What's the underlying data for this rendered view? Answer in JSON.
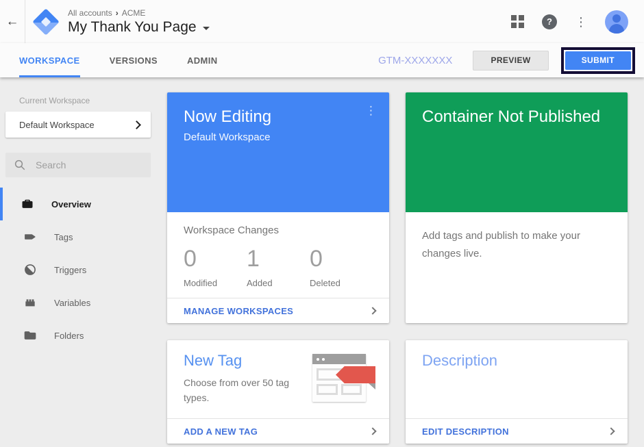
{
  "topbar": {
    "back_glyph": "←",
    "breadcrumb": {
      "account_level": "All accounts",
      "separator": "›",
      "account": "ACME"
    },
    "title": "My Thank You Page",
    "help_glyph": "?",
    "more_glyph": "⋮",
    "now_editing_dots": "⋮"
  },
  "tabbar": {
    "tabs": [
      {
        "label": "WORKSPACE",
        "active": true
      },
      {
        "label": "VERSIONS",
        "active": false
      },
      {
        "label": "ADMIN",
        "active": false
      }
    ],
    "container_id": "GTM-XXXXXXX",
    "preview_label": "PREVIEW",
    "submit_label": "SUBMIT"
  },
  "sidebar": {
    "current_workspace_label": "Current Workspace",
    "workspace_name": "Default Workspace",
    "search_placeholder": "Search",
    "nav": [
      {
        "label": "Overview",
        "icon": "overview-icon",
        "selected": true
      },
      {
        "label": "Tags",
        "icon": "tag-icon",
        "selected": false
      },
      {
        "label": "Triggers",
        "icon": "trigger-icon",
        "selected": false
      },
      {
        "label": "Variables",
        "icon": "variable-icon",
        "selected": false
      },
      {
        "label": "Folders",
        "icon": "folder-icon",
        "selected": false
      }
    ]
  },
  "cards": {
    "now_editing": {
      "title": "Now Editing",
      "subtitle": "Default Workspace",
      "section_title": "Workspace Changes",
      "stats": [
        {
          "value": "0",
          "label": "Modified"
        },
        {
          "value": "1",
          "label": "Added"
        },
        {
          "value": "0",
          "label": "Deleted"
        }
      ],
      "footer_label": "MANAGE WORKSPACES"
    },
    "container_status": {
      "title": "Container Not Published",
      "body": "Add tags and publish to make your changes live."
    },
    "new_tag": {
      "title": "New Tag",
      "body": "Choose from over 50 tag types.",
      "footer_label": "ADD A NEW TAG"
    },
    "description": {
      "title": "Description",
      "footer_label": "EDIT DESCRIPTION"
    }
  },
  "colors": {
    "accent_blue": "#4285f4",
    "published_green": "#0f9d58",
    "tag_red": "#e2574d",
    "link_blue": "#4272db",
    "container_id_blue": "#9da6e9",
    "submit_highlight_outline": "#140d35"
  }
}
